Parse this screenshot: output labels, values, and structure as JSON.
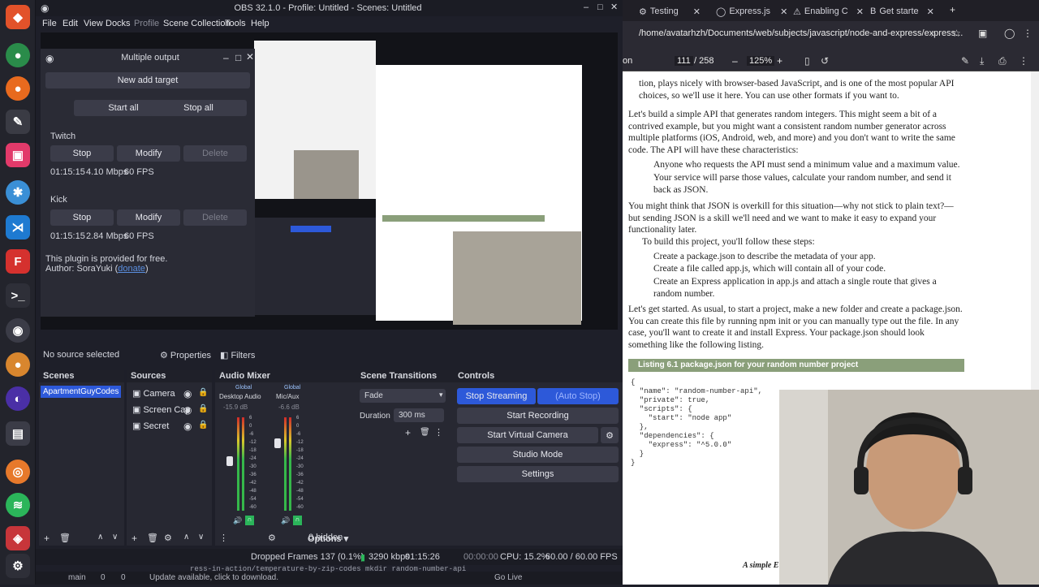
{
  "obs": {
    "title": "OBS 32.1.0 - Profile: Untitled - Scenes: Untitled",
    "menu": [
      "File",
      "Edit",
      "View",
      "Docks",
      "Profile",
      "Scene Collection",
      "Tools",
      "Help"
    ],
    "multiple_output": {
      "title": "Multiple output",
      "add_target": "New add target",
      "start_all": "Start all",
      "stop_all": "Stop all",
      "targets": [
        {
          "name": "Twitch",
          "stop": "Stop",
          "modify": "Modify",
          "delete": "Delete",
          "time": "01:15:15",
          "bitrate": "4.10 Mbps",
          "fps": "60 FPS"
        },
        {
          "name": "Kick",
          "stop": "Stop",
          "modify": "Modify",
          "delete": "Delete",
          "time": "01:15:15",
          "bitrate": "2.84 Mbps",
          "fps": "60 FPS"
        }
      ],
      "footer1": "This plugin is provided for free.",
      "footer2_prefix": "Author: SoraYuki (",
      "footer2_link": "donate",
      "footer2_suffix": ")"
    },
    "no_source": "No source selected",
    "properties": "Properties",
    "filters": "Filters",
    "scenes": {
      "header": "Scenes",
      "items": [
        "ApartmentGuyCodes"
      ]
    },
    "sources": {
      "header": "Sources",
      "items": [
        "Camera",
        "Screen Cap",
        "Secret"
      ]
    },
    "mixer": {
      "header": "Audio Mixer",
      "channels": [
        {
          "tag": "Global",
          "name": "Desktop Audio",
          "db": "-15.9 dB"
        },
        {
          "tag": "Global",
          "name": "Mic/Aux",
          "db": "-6.6 dB"
        }
      ],
      "scale": [
        "6",
        "0",
        "-6",
        "-12",
        "-18",
        "-24",
        "-30",
        "-36",
        "-42",
        "-48",
        "-54",
        "-60"
      ]
    },
    "transitions": {
      "header": "Scene Transitions",
      "type": "Fade",
      "duration_label": "Duration",
      "duration": "300 ms"
    },
    "controls": {
      "header": "Controls",
      "stop_streaming": "Stop Streaming",
      "auto_stop": "(Auto Stop)",
      "start_recording": "Start Recording",
      "start_virtual_camera": "Start Virtual Camera",
      "studio_mode": "Studio Mode",
      "settings": "Settings"
    },
    "sources_footer": "0 hidden",
    "options": "Options",
    "status": {
      "dropped": "Dropped Frames 137 (0.1%)",
      "kbps": "3290 kbps",
      "stream_time": "01:15:26",
      "rec_time": "00:00:00",
      "cpu": "CPU: 15.2%",
      "fps": "60.00 / 60.00 FPS"
    },
    "vscode": {
      "branch": "main",
      "errors": "0",
      "warnings": "0",
      "update": "Update available, click to download.",
      "golive": "Go Live",
      "terminal": "ress-in-action/temperature-by-zip-codes mkdir random-number-api"
    }
  },
  "browser": {
    "tabs": [
      "Testing",
      "Express.js",
      "Enabling C",
      "Get starte"
    ],
    "url": "/home/avatarhzh/Documents/web/subjects/javascript/node-and-express/express...",
    "sidebar_label": "on",
    "page": "111",
    "page_total": "/ 258",
    "zoom": "125%",
    "pdf": {
      "p0": "tion, plays nicely with browser-based JavaScript, and is one of the most popular API choices, so we'll use it here. You can use other formats if you want to.",
      "p1": "Let's build a simple API that generates random integers. This might seem a bit of a contrived example, but you might want a consistent random number generator across multiple platforms (iOS, Android, web, and more) and you don't want to write the same code. The API will have these characteristics:",
      "b1": "Anyone who requests the API must send a minimum value and a maximum value.",
      "b2": "Your service will parse those values, calculate your random number, and send it back as JSON.",
      "p2": "You might think that JSON is overkill for this situation—why not stick to plain text?—but sending JSON is a skill we'll need and we want to make it easy to expand your functionality later.",
      "p3": "To build this project, you'll follow these steps:",
      "s1": "Create a package.json to describe the metadata of your app.",
      "s2": "Create a file called app.js, which will contain all of your code.",
      "s3": "Create an Express application in app.js and attach a single route that gives a random number.",
      "p4": "Let's get started. As usual, to start a project, make a new folder and create a package.json. You can create this file by running npm init or you can manually type out the file. In any case, you'll want to create it and install Express. Your package.json should look something like the following listing.",
      "listing": "Listing 6.1    package.json for your random number project",
      "code": "{\n  \"name\": \"random-number-api\",\n  \"private\": true,\n  \"scripts\": {\n    \"start\": \"node app\"\n  },\n  \"dependencies\": {\n    \"express\": \"^5.0.0\"\n  }\n}",
      "footer": "A simple E"
    }
  },
  "colors": {
    "accent": "#2d59d9",
    "obs_bg": "#1e1f29",
    "listing_bg": "#8a9f7a"
  }
}
